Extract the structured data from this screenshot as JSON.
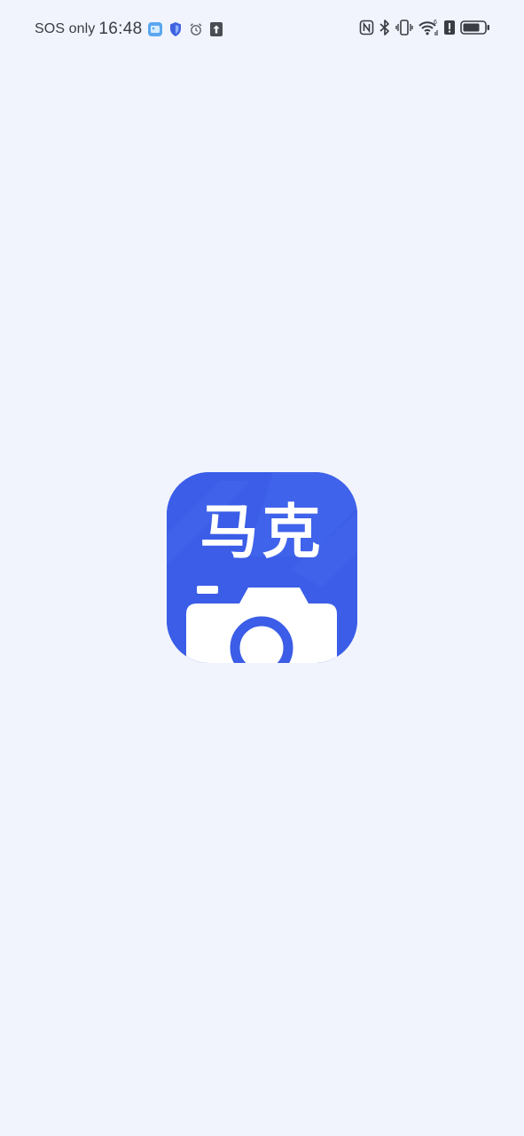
{
  "status_bar": {
    "carrier": "SOS only",
    "time": "16:48",
    "left_icons": [
      "gallery-notification-icon",
      "shield-icon",
      "alarm-icon",
      "upload-icon"
    ],
    "right_icons": [
      "nfc-icon",
      "bluetooth-icon",
      "vibrate-icon",
      "wifi-6-icon",
      "alert-icon",
      "battery-icon"
    ]
  },
  "splash": {
    "app_logo_text": "马克",
    "logo_colors": {
      "background": "#3b5de7",
      "stripe": "#4a6cf0",
      "camera_body": "#ffffff",
      "lens_ring": "#3b5de7"
    }
  },
  "colors": {
    "page_background": "#f1f4fc",
    "status_text": "#3a3d44"
  }
}
